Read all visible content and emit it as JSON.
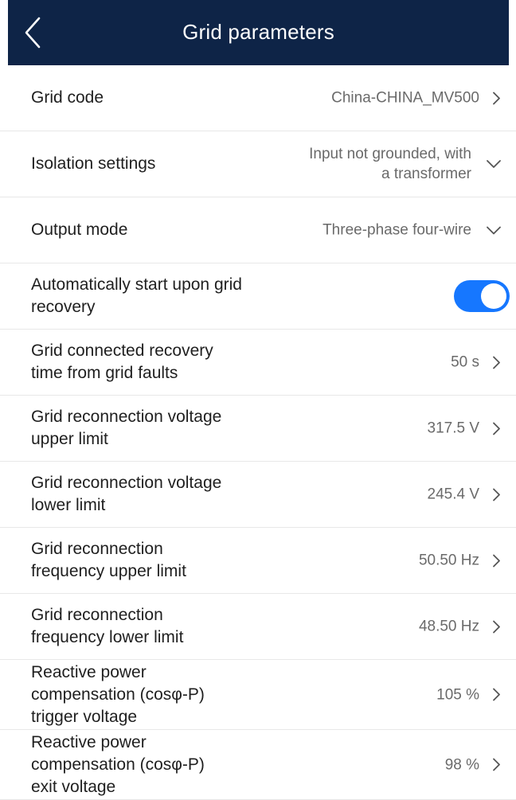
{
  "header": {
    "title": "Grid parameters",
    "back_icon": "chevron-left-icon",
    "background": "#0e2447"
  },
  "rows": [
    {
      "label": "Grid code",
      "value": "China-CHINA_MV500",
      "control": "chevron-right"
    },
    {
      "label": "Isolation settings",
      "value_line1": "Input not grounded, with",
      "value_line2": "a transformer",
      "control": "chevron-down"
    },
    {
      "label": "Output mode",
      "value": "Three-phase four-wire",
      "control": "chevron-down"
    },
    {
      "label_line1": "Automatically start upon grid",
      "label_line2": "recovery",
      "control": "toggle",
      "toggle_on": true,
      "toggle_color": "#1677ff"
    },
    {
      "label_line1": "Grid connected recovery",
      "label_line2": "time from grid faults",
      "value": "50 s",
      "control": "chevron-right"
    },
    {
      "label_line1": "Grid reconnection voltage",
      "label_line2": "upper limit",
      "value": "317.5 V",
      "control": "chevron-right"
    },
    {
      "label_line1": "Grid reconnection voltage",
      "label_line2": "lower limit",
      "value": "245.4 V",
      "control": "chevron-right"
    },
    {
      "label_line1": "Grid reconnection",
      "label_line2": "frequency upper limit",
      "value": "50.50 Hz",
      "control": "chevron-right"
    },
    {
      "label_line1": "Grid reconnection",
      "label_line2": "frequency lower limit",
      "value": "48.50 Hz",
      "control": "chevron-right"
    },
    {
      "label_line1": "Reactive power",
      "label_line2": "compensation (cosφ-P)",
      "label_line3": "trigger voltage",
      "value": "105 %",
      "control": "chevron-right"
    },
    {
      "label_line1": "Reactive power",
      "label_line2": "compensation (cosφ-P)",
      "label_line3": "exit voltage",
      "value": "98 %",
      "control": "chevron-right"
    }
  ]
}
